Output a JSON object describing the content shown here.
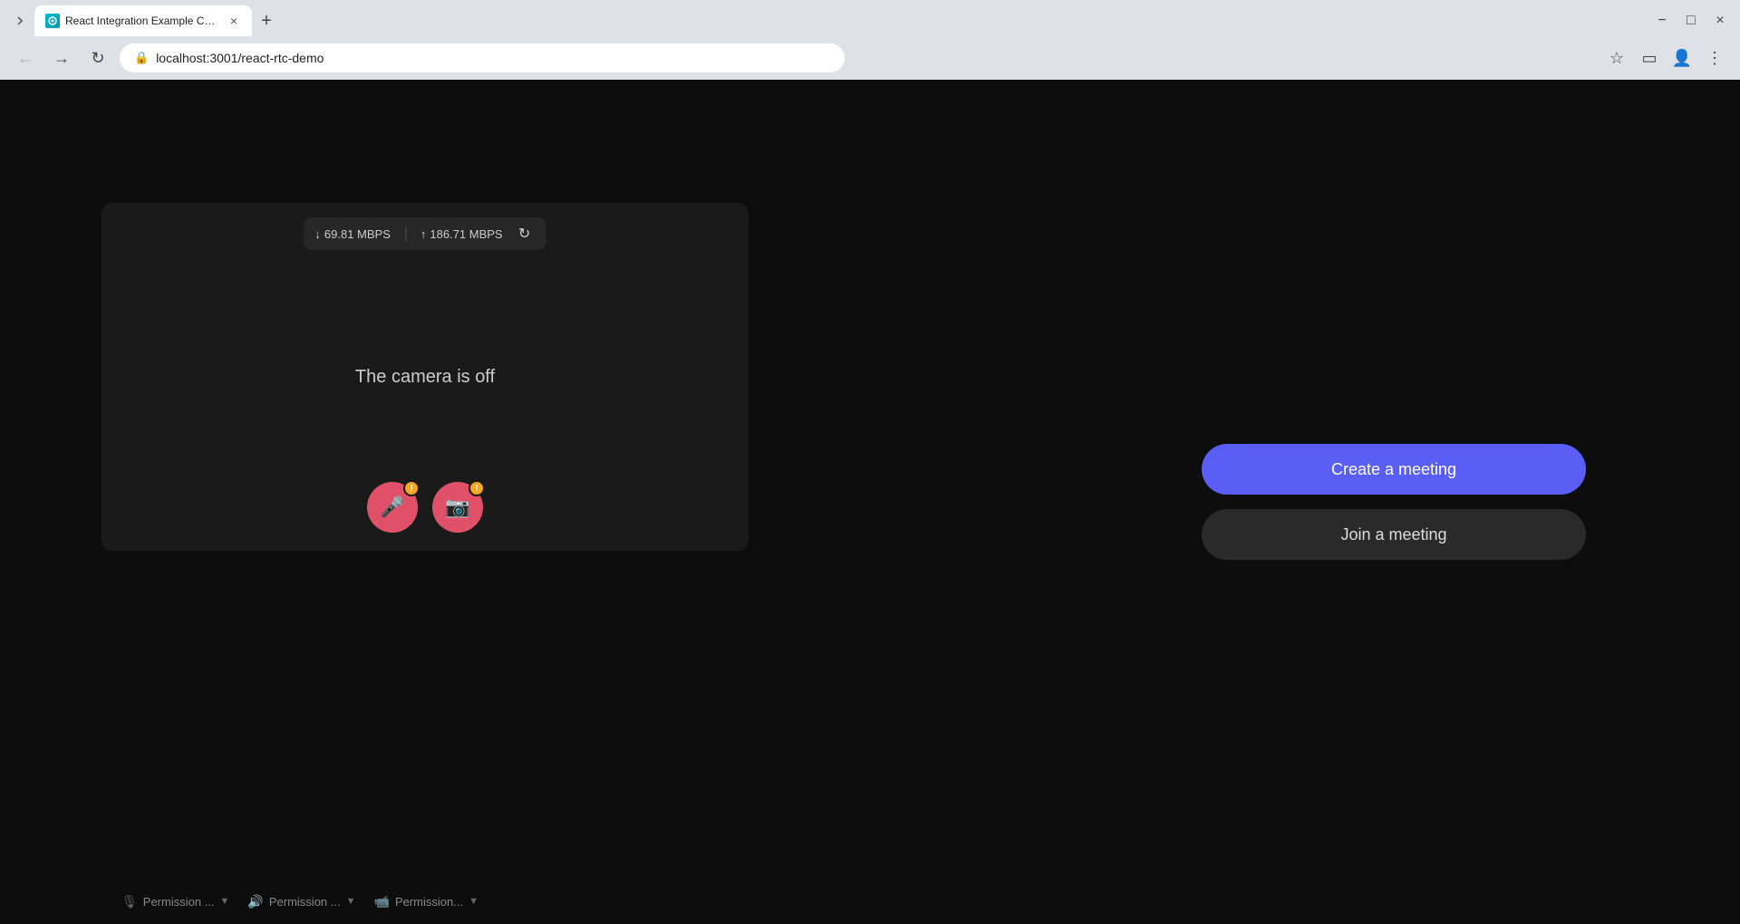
{
  "browser": {
    "tab": {
      "title": "React Integration Example Cod...",
      "favicon_alt": "react-rtc-favicon"
    },
    "url": "localhost:3001/react-rtc-demo",
    "new_tab_label": "+",
    "window_controls": {
      "minimize": "−",
      "maximize": "□",
      "close": "×"
    }
  },
  "video_panel": {
    "camera_off_text": "The camera is off",
    "stats": {
      "download_speed": "69.81 MBPS",
      "upload_speed": "186.71 MBPS",
      "download_arrow": "↓",
      "upload_arrow": "↑"
    },
    "controls": {
      "mute_badge": "!",
      "video_badge": "!"
    }
  },
  "permissions": {
    "mic_label": "Permission ...",
    "speaker_label": "Permission ...",
    "camera_label": "Permission..."
  },
  "actions": {
    "create_meeting_label": "Create a meeting",
    "join_meeting_label": "Join a meeting"
  }
}
